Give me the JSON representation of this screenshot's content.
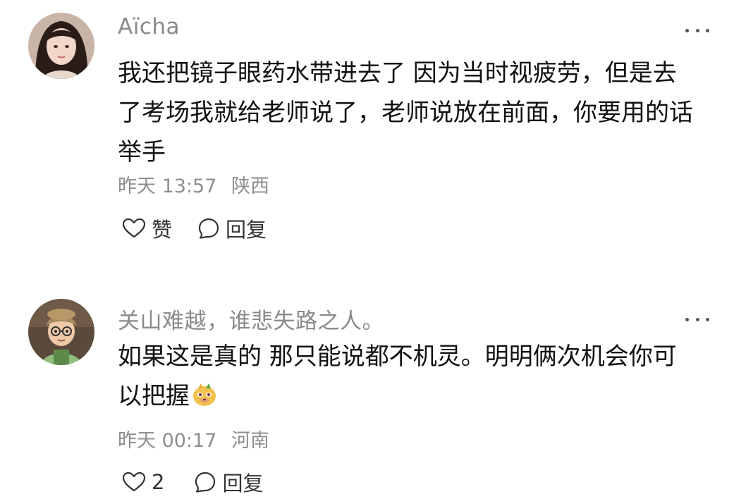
{
  "comments": [
    {
      "username": "Aïcha",
      "avatar": "woman-portrait-avatar",
      "content": "我还把镜子眼药水带进去了 因为当时视疲劳，但是去\n了考场我就给老师说了，老师说放在前面，你要用的话\n举手",
      "time": "昨天 13:57",
      "location": "陕西",
      "like_label": "赞",
      "reply_label": "回复"
    },
    {
      "username": "关山难越，谁悲失路之人。",
      "avatar": "cartoon-boy-avatar",
      "content": "如果这是真的 那只能说都不机灵。明明俩次机会你可\n以把握",
      "emoji": "doge-emoji-icon",
      "time": "昨天 00:17",
      "location": "河南",
      "like_label": "2",
      "reply_label": "回复"
    }
  ],
  "colors": {
    "username": "#8a8a8a",
    "meta": "#8e8e8e",
    "text": "#111111"
  }
}
